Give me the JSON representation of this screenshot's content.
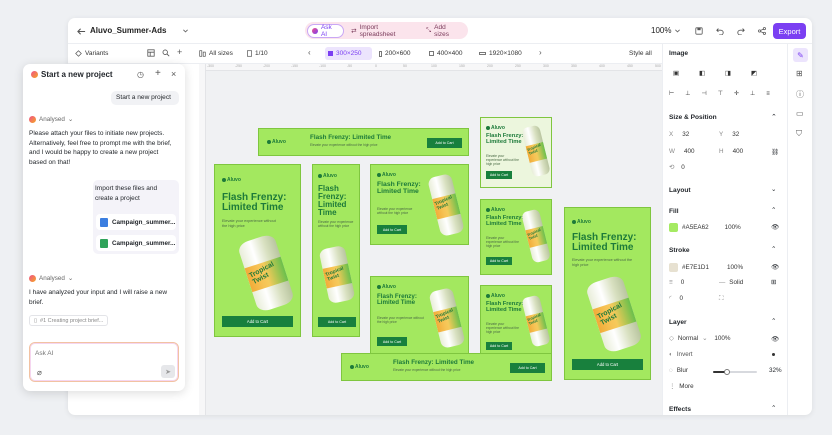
{
  "window": {
    "project_name": "Aluvo_Summer-Ads",
    "pills": [
      "Ask AI",
      "Import spreadsheet",
      "Add sizes"
    ],
    "zoom": "100%",
    "export_label": "Export"
  },
  "toolbar": {
    "variants_label": "Variants",
    "all_sizes_label": "All sizes",
    "page_count": "1/10",
    "sizes": [
      "300×250",
      "200×600",
      "400×400",
      "1920×1080"
    ],
    "style_all_label": "Style all"
  },
  "ruler": [
    "-300",
    "-250",
    "-200",
    "-150",
    "-100",
    "-50",
    "0",
    "50",
    "100",
    "150",
    "200",
    "250",
    "300",
    "350",
    "400",
    "450",
    "500"
  ],
  "chat": {
    "title": "Start a new project",
    "user_msg_1": "Start a new project",
    "analysed_label": "Analysed",
    "assistant_msg_1": "Please attach your files to initiate new projects. Alternatively, feel free to prompt me with the brief, and I would be happy to create a new project based on that!",
    "user_msg_2": "Import these files and create a project",
    "files": [
      "Campaign_summer...",
      "Campaign_summer..."
    ],
    "assistant_msg_2": "I have analyzed your input and I will raise a new brief.",
    "status_chip": "#1 Creating project brief...",
    "input_placeholder": "Ask AI"
  },
  "ads": {
    "brand": "Aluvo",
    "headline": "Flash Frenzy: Limited Time",
    "tagline": "Elevate your experience without the high price",
    "cta": "Add to Cart",
    "can_text": "Tropical Twist"
  },
  "panel": {
    "image_label": "Image",
    "size_position_label": "Size & Position",
    "x_label": "X",
    "x_value": "32",
    "y_label": "Y",
    "y_value": "32",
    "w_label": "W",
    "w_value": "400",
    "h_label": "H",
    "h_value": "400",
    "rotation_value": "0",
    "layout_label": "Layout",
    "fill_label": "Fill",
    "fill_hex": "#A5EA62",
    "fill_opacity": "100%",
    "stroke_label": "Stroke",
    "stroke_hex": "#E7E1D1",
    "stroke_opacity": "100%",
    "stroke_width": "0",
    "stroke_style": "Solid",
    "corner_value": "0",
    "layer_label": "Layer",
    "blend_mode": "Normal",
    "layer_opacity": "100%",
    "invert_label": "Invert",
    "blur_label": "Blur",
    "blur_value": "32%",
    "blur_level": 0.32,
    "more_label": "More",
    "effects_label": "Effects"
  },
  "colors": {
    "accent": "#7b3ff2",
    "fill_swatch": "#A5EA62",
    "stroke_swatch": "#E7E1D1",
    "ad_green": "#a3e85f",
    "ad_dark": "#1d7a3a"
  }
}
